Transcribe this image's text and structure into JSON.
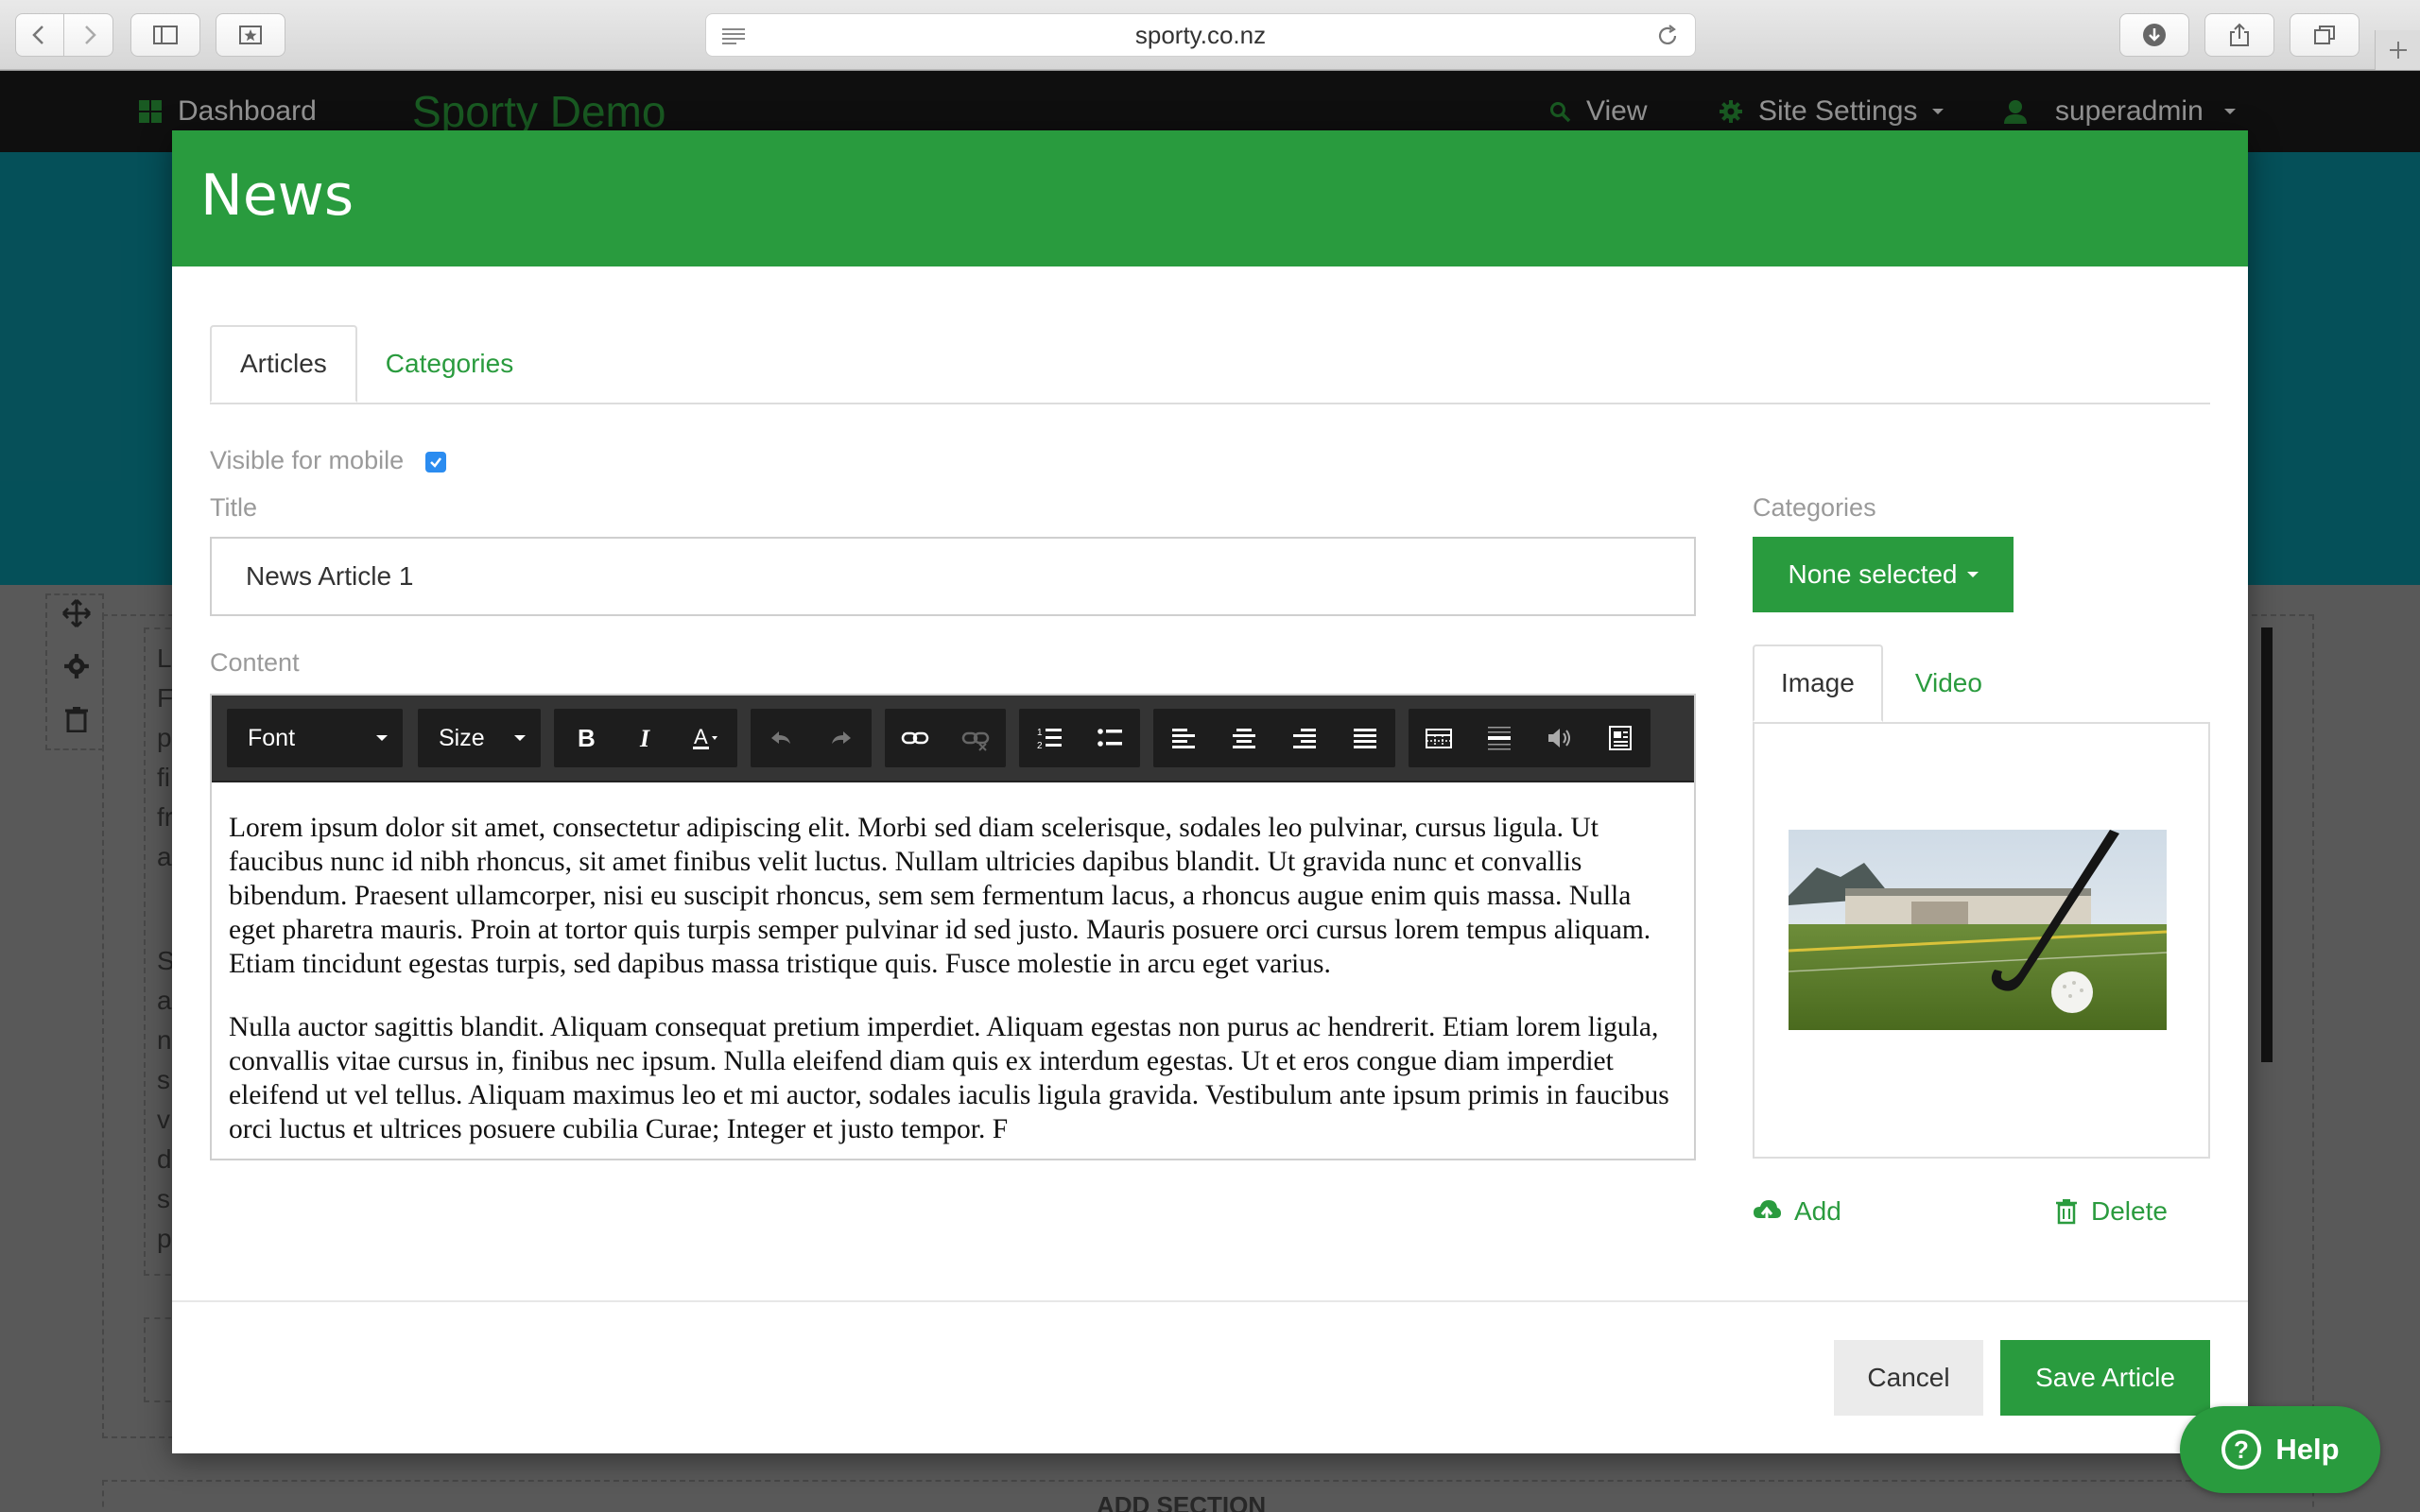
{
  "browser": {
    "url": "sporty.co.nz",
    "icons": [
      "back-icon",
      "forward-icon",
      "sidebar-icon",
      "bookmarks-icon",
      "reader-icon",
      "reload-icon",
      "download-icon",
      "share-icon",
      "tabs-icon",
      "new-tab-icon"
    ]
  },
  "site_nav": {
    "dashboard_label": "Dashboard",
    "brand": "Sporty Demo",
    "view_label": "View",
    "site_settings_label": "Site Settings",
    "user_label": "superadmin"
  },
  "background_page": {
    "left_column_letters": [
      "L",
      "F",
      "p",
      "fi",
      "fr",
      "a"
    ],
    "left_column_letters_2": [
      "S",
      "a",
      "n",
      "s",
      "v",
      "d",
      "s",
      "p"
    ],
    "add_section_label": "ADD SECTION"
  },
  "modal": {
    "title": "News",
    "tabs": [
      {
        "label": "Articles",
        "active": true
      },
      {
        "label": "Categories",
        "active": false
      }
    ],
    "visible_for_mobile_label": "Visible for mobile",
    "visible_for_mobile_checked": true,
    "title_label": "Title",
    "title_value": "News Article 1",
    "content_label": "Content",
    "editor": {
      "font_label": "Font",
      "size_label": "Size",
      "toolbar_icons": [
        "bold-icon",
        "italic-icon",
        "text-color-icon",
        "undo-icon",
        "redo-icon",
        "link-icon",
        "unlink-icon",
        "ordered-list-icon",
        "unordered-list-icon",
        "align-left-icon",
        "align-center-icon",
        "align-right-icon",
        "align-justify-icon",
        "table-icon",
        "horizontal-rule-icon",
        "audio-icon",
        "media-icon"
      ],
      "paragraphs": [
        "Lorem ipsum dolor sit amet, consectetur adipiscing elit. Morbi sed diam scelerisque, sodales leo pulvinar, cursus ligula. Ut faucibus nunc id nibh rhoncus, sit amet finibus velit luctus. Nullam ultricies dapibus blandit. Ut gravida nunc et convallis bibendum. Praesent ullamcorper, nisi eu suscipit rhoncus, sem sem fermentum lacus, a rhoncus augue enim quis massa. Nulla eget pharetra mauris. Proin at tortor quis turpis semper pulvinar id sed justo. Mauris posuere orci cursus lorem tempus aliquam. Etiam tincidunt egestas turpis, sed dapibus massa tristique quis. Fusce molestie in arcu eget varius.",
        "Nulla auctor sagittis blandit. Aliquam consequat pretium imperdiet. Aliquam egestas non purus ac hendrerit. Etiam lorem ligula, convallis vitae cursus in, finibus nec ipsum. Nulla eleifend diam quis ex interdum egestas. Ut et eros congue diam imperdiet eleifend ut vel tellus. Aliquam maximus leo et mi auctor, sodales iaculis ligula gravida. Vestibulum ante ipsum primis in faucibus orci luctus et ultrices posuere cubilia Curae; Integer et justo tempor. F"
      ]
    },
    "categories_label": "Categories",
    "categories_dropdown": "None selected",
    "media_tabs": [
      {
        "label": "Image",
        "active": true
      },
      {
        "label": "Video",
        "active": false
      }
    ],
    "add_label": "Add",
    "delete_label": "Delete",
    "cancel_label": "Cancel",
    "save_label": "Save Article"
  },
  "help_label": "Help",
  "colors": {
    "brand_green": "#299b3e",
    "checkbox_blue": "#2b8cf0",
    "hero_teal": "#0a8a99",
    "nav_dark": "#1b1b1b"
  }
}
